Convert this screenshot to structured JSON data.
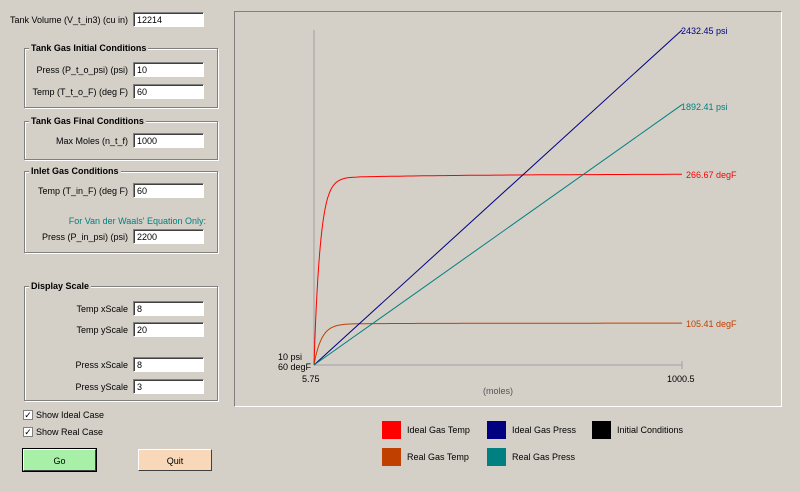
{
  "tank_volume": {
    "label": "Tank Volume (V_t_in3) (cu in)",
    "value": "12214"
  },
  "initial": {
    "title": "Tank Gas Initial Conditions",
    "press_label": "Press (P_t_o_psi) (psi)",
    "press_value": "10",
    "temp_label": "Temp (T_t_o_F) (deg F)",
    "temp_value": "60"
  },
  "final": {
    "title": "Tank Gas Final Conditions",
    "moles_label": "Max Moles (n_t_f)",
    "moles_value": "1000"
  },
  "inlet": {
    "title": "Inlet Gas Conditions",
    "temp_label": "Temp (T_in_F) (deg F)",
    "temp_value": "60",
    "vdw_note": "For Van der Waals' Equation Only:",
    "press_label": "Press (P_in_psi) (psi)",
    "press_value": "2200"
  },
  "scale": {
    "title": "Display Scale",
    "temp_x_label": "Temp xScale",
    "temp_x_value": "8",
    "temp_y_label": "Temp yScale",
    "temp_y_value": "20",
    "press_x_label": "Press xScale",
    "press_x_value": "8",
    "press_y_label": "Press yScale",
    "press_y_value": "3"
  },
  "options": {
    "show_ideal": "Show Ideal Case",
    "show_ideal_checked": true,
    "show_real": "Show Real Case",
    "show_real_checked": true
  },
  "buttons": {
    "go": "Go",
    "quit": "Quit"
  },
  "plot": {
    "x_min_label": "5.75",
    "x_max_label": "1000.5",
    "x_axis_label": "(moles)",
    "origin_press": "10 psi",
    "origin_temp": "60 degF",
    "end_ideal_press": "2432.45 psi",
    "end_real_press": "1892.41 psi",
    "end_ideal_temp": "266.67 degF",
    "end_real_temp": "105.41 degF"
  },
  "legend": {
    "ideal_temp": "Ideal Gas Temp",
    "ideal_press": "Ideal Gas Press",
    "initial": "Initial Conditions",
    "real_temp": "Real Gas Temp",
    "real_press": "Real Gas Press"
  },
  "colors": {
    "ideal_temp": "#ff0000",
    "real_temp": "#c04000",
    "ideal_press": "#000080",
    "real_press": "#008080",
    "initial": "#000000"
  },
  "chart_data": {
    "type": "line",
    "xlabel": "(moles)",
    "xlim": [
      5.75,
      1000.5
    ],
    "series": [
      {
        "name": "Ideal Gas Temp",
        "x": [
          5.75,
          20,
          50,
          100,
          200,
          1000.5
        ],
        "y": [
          60,
          225,
          252,
          260,
          264,
          266.67
        ],
        "unit": "degF"
      },
      {
        "name": "Real Gas Temp",
        "x": [
          5.75,
          20,
          50,
          100,
          200,
          1000.5
        ],
        "y": [
          60,
          90,
          100,
          103,
          104,
          105.41
        ],
        "unit": "degF"
      },
      {
        "name": "Ideal Gas Press",
        "x": [
          5.75,
          1000.5
        ],
        "y": [
          10,
          2432.45
        ],
        "unit": "psi"
      },
      {
        "name": "Real Gas Press",
        "x": [
          5.75,
          1000.5
        ],
        "y": [
          10,
          1892.41
        ],
        "unit": "psi"
      }
    ]
  }
}
